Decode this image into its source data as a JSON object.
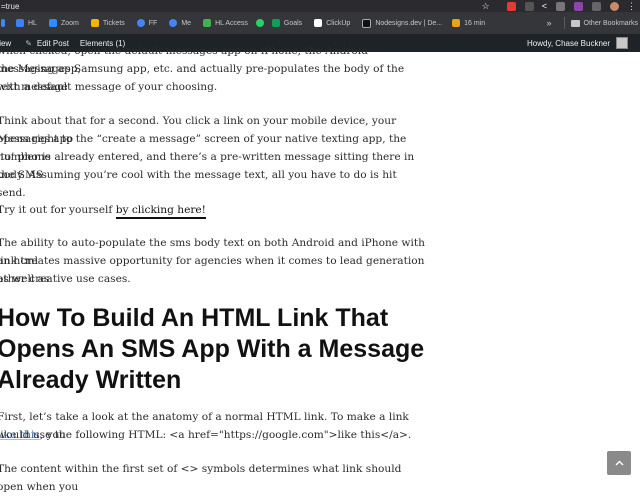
{
  "browser": {
    "url": "=true",
    "bookmarks": [
      {
        "label": "HL",
        "color": "#3b82f6"
      },
      {
        "label": "Zoom",
        "color": "#2d8cff"
      },
      {
        "label": "Tickets",
        "color": "#f5b400"
      },
      {
        "label": "FF",
        "color": "#4285f4"
      },
      {
        "label": "Me",
        "color": "#4285f4"
      },
      {
        "label": "HL Access",
        "color": "#3fb34f"
      },
      {
        "label": "",
        "color": "#25d366"
      },
      {
        "label": "Goals",
        "color": "#0f9d58"
      },
      {
        "label": "ClickUp",
        "color": "#ffffff"
      },
      {
        "label": "Nodesigns.dev | De...",
        "color": "#111111"
      },
      {
        "label": "16 min",
        "color": "#e8a317"
      }
    ],
    "more_glyph": "»",
    "other_bookmarks": "Other Bookmarks"
  },
  "admin_bar": {
    "view": "View",
    "edit_post": "Edit Post",
    "elements": "Elements (1)",
    "howdy": "Howdy, Chase Buckner"
  },
  "article": {
    "p1_line1": "when clicked, open the default messages app on iPhone, the Android messaging app,",
    "p1_line2": "the Messages Samsung app, etc. and actually pre-populates the body of the text message",
    "p1_line3": "with a default message of your choosing.",
    "p2_line1": "Think about that for a second. You click a link on your mobile device, your Messages app",
    "p2_line2": "opens right to the “create a message” screen of your native texting app, the ‘to’ phone",
    "p2_line3": "number is already entered, and there’s a pre-written message sitting there in the SMS",
    "p2_line4": "body. Assuming you’re cool with the message text, all you have to do is hit send.",
    "p3_prefix": "Try it out for yourself ",
    "p3_link": "by clicking here!",
    "p4_line1": "The ability to auto-populate the sms body text on both Android and iPhone with an html",
    "p4_line2": "link creates massive opportunity for agencies when it comes to lead generation as well as",
    "p4_line3": "other creative use cases.",
    "heading_line1": "How To Build An HTML Link That",
    "heading_line2": "Opens An SMS App With a Message",
    "heading_line3": "Already Written",
    "p5_prefix": "First, let’s take a look at the anatomy of a normal HTML link. To make a link ",
    "p5_link": "like this",
    "p5_suffix": ", you",
    "p5_line2": "would use the following HTML: <a href=\"https://google.com\">like this</a>.",
    "p6_line1": "The content within the first set of <> symbols determines what link should open when you"
  },
  "scroll_top_icon": "chevron-up-icon"
}
